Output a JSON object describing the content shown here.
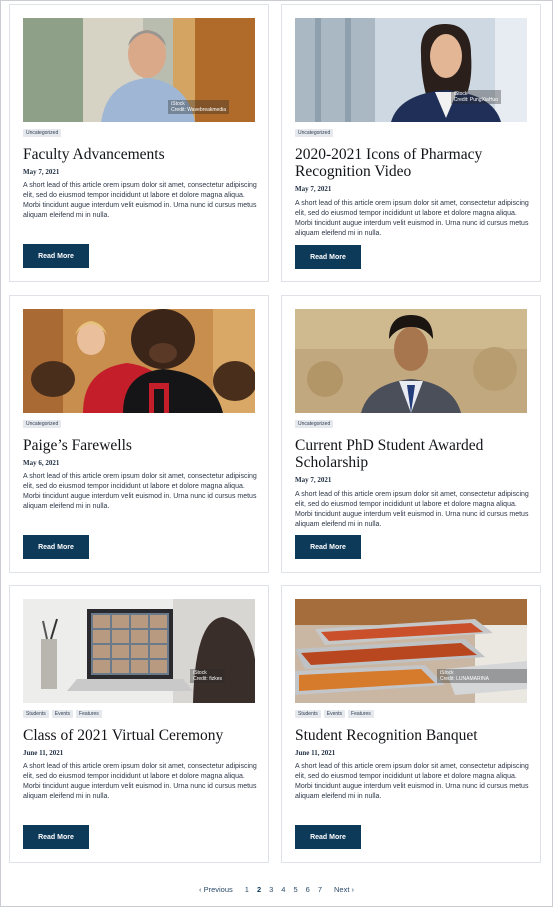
{
  "cards": [
    {
      "tags": [
        "Uncategorized"
      ],
      "title": "Faculty Advancements",
      "date": "May 7, 2021",
      "lead": "A short lead of this article orem ipsum dolor sit amet, consectetur adipiscing elit, sed do eiusmod tempor incididunt ut labore et dolore magna aliqua. Morbi tincidunt augue interdum velit euismod in. Urna nunc id cursus metus aliquam eleifend mi in nulla.",
      "button": "Read More",
      "watermark": "iStock",
      "credit": "Credit: Wavebreakmedia"
    },
    {
      "tags": [
        "Uncategorized"
      ],
      "title": "2020-2021 Icons of Pharmacy Recognition Video",
      "date": "May 7, 2021",
      "lead": "A short lead of this article orem ipsum dolor sit amet, consectetur adipiscing elit, sed do eiusmod tempor incididunt ut labore et dolore magna aliqua. Morbi tincidunt augue interdum velit euismod in. Urna nunc id cursus metus aliquam eleifend mi in nulla.",
      "button": "Read More",
      "watermark": "iStock",
      "credit": "Credit: PungXiaHuo"
    },
    {
      "tags": [
        "Uncategorized"
      ],
      "title": "Paige’s Farewells",
      "date": "May 6, 2021",
      "lead": "A short lead of this article orem ipsum dolor sit amet, consectetur adipiscing elit, sed do eiusmod tempor incididunt ut labore et dolore magna aliqua. Morbi tincidunt augue interdum velit euismod in. Urna nunc id cursus metus aliquam eleifend mi in nulla.",
      "button": "Read More"
    },
    {
      "tags": [
        "Uncategorized"
      ],
      "title": "Current PhD Student Awarded Scholarship",
      "date": "May 7, 2021",
      "lead": "A short lead of this article orem ipsum dolor sit amet, consectetur adipiscing elit, sed do eiusmod tempor incididunt ut labore et dolore magna aliqua. Morbi tincidunt augue interdum velit euismod in. Urna nunc id cursus metus aliquam eleifend mi in nulla.",
      "button": "Read More"
    },
    {
      "tags": [
        "Students",
        "Events",
        "Features"
      ],
      "title": "Class of 2021 Virtual Ceremony",
      "date": "June 11, 2021",
      "lead": "A short lead of this article orem ipsum dolor sit amet, consectetur adipiscing elit, sed do eiusmod tempor incididunt ut labore et dolore magna aliqua. Morbi tincidunt augue interdum velit euismod in. Urna nunc id cursus metus aliquam eleifend mi in nulla.",
      "button": "Read More",
      "watermark": "iStock",
      "credit": "Credit: fizkes"
    },
    {
      "tags": [
        "Students",
        "Events",
        "Features"
      ],
      "title": "Student Recognition Banquet",
      "date": "June 11, 2021",
      "lead": "A short lead of this article orem ipsum dolor sit amet, consectetur adipiscing elit, sed do eiusmod tempor incididunt ut labore et dolore magna aliqua. Morbi tincidunt augue interdum velit euismod in. Urna nunc id cursus metus aliquam eleifend mi in nulla.",
      "button": "Read More",
      "watermark": "iStock",
      "credit": "Credit: LUNAMARINA"
    }
  ],
  "pagination": {
    "previous": "Previous",
    "next": "Next",
    "pages": [
      "1",
      "2",
      "3",
      "4",
      "5",
      "6",
      "7"
    ],
    "current": "2"
  },
  "colors": {
    "button": "#0e3a5a",
    "tag_bg": "#e5e8ec",
    "link": "#2b4b69"
  }
}
